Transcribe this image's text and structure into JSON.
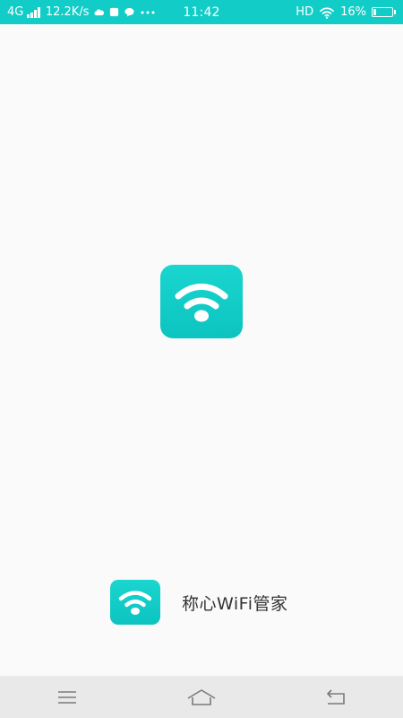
{
  "status_bar": {
    "network": "4G",
    "speed": "12.2K/s",
    "time": "11:42",
    "hd": "HD",
    "battery_percent": "16%",
    "battery_level": 0.16,
    "accent_color": "#12cdc7",
    "notification_icons": [
      "cloud-icon",
      "app-square-icon",
      "chat-bubble-icon",
      "more-dots-icon"
    ]
  },
  "splash": {
    "logo_icon": "wifi-icon",
    "logo_color": "#12cdc7"
  },
  "brand": {
    "logo_icon": "wifi-icon",
    "name": "称心WiFi管家"
  },
  "nav_bar": {
    "buttons": [
      "menu-icon",
      "home-icon",
      "back-icon"
    ]
  }
}
